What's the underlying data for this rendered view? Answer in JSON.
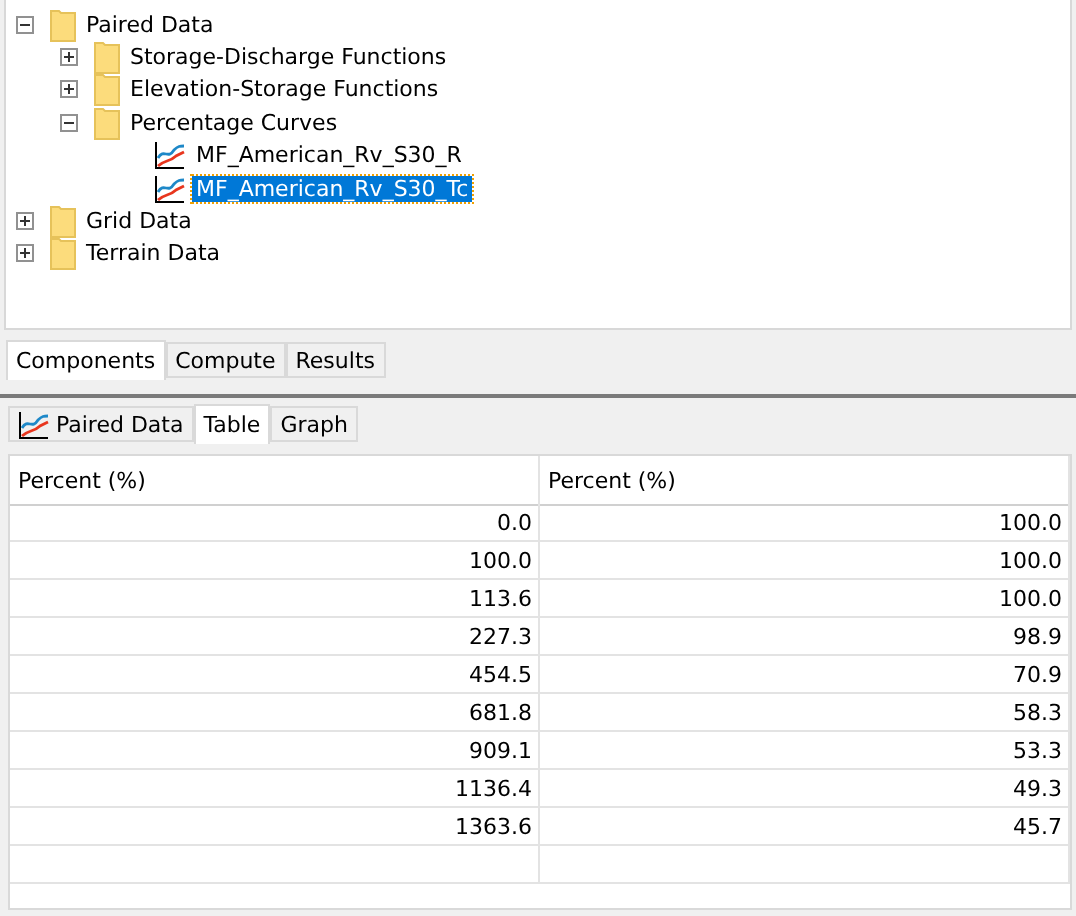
{
  "tree": {
    "items": [
      {
        "label": "Paired Data",
        "kind": "folder",
        "expanded": true,
        "selected": false,
        "children": [
          {
            "label": "Storage-Discharge Functions",
            "kind": "folder",
            "expanded": false,
            "selected": false
          },
          {
            "label": "Elevation-Storage Functions",
            "kind": "folder",
            "expanded": false,
            "selected": false
          },
          {
            "label": "Percentage Curves",
            "kind": "folder",
            "expanded": true,
            "selected": false,
            "children": [
              {
                "label": "MF_American_Rv_S30_R",
                "kind": "curve",
                "selected": false
              },
              {
                "label": "MF_American_Rv_S30_Tc",
                "kind": "curve",
                "selected": true
              }
            ]
          }
        ]
      },
      {
        "label": "Grid Data",
        "kind": "folder",
        "expanded": false,
        "selected": false
      },
      {
        "label": "Terrain Data",
        "kind": "folder",
        "expanded": false,
        "selected": false
      }
    ]
  },
  "panel_tabs": [
    {
      "label": "Components",
      "selected": true
    },
    {
      "label": "Compute",
      "selected": false
    },
    {
      "label": "Results",
      "selected": false
    }
  ],
  "editor_tabs": [
    {
      "label": "Paired Data",
      "icon": true,
      "selected": false
    },
    {
      "label": "Table",
      "icon": false,
      "selected": true
    },
    {
      "label": "Graph",
      "icon": false,
      "selected": false
    }
  ],
  "table": {
    "columns": [
      "Percent (%)",
      "Percent (%)"
    ],
    "rows": [
      [
        "0.0",
        "100.0"
      ],
      [
        "100.0",
        "100.0"
      ],
      [
        "113.6",
        "100.0"
      ],
      [
        "227.3",
        "98.9"
      ],
      [
        "454.5",
        "70.9"
      ],
      [
        "681.8",
        "58.3"
      ],
      [
        "909.1",
        "53.3"
      ],
      [
        "1136.4",
        "49.3"
      ],
      [
        "1363.6",
        "45.7"
      ]
    ]
  }
}
